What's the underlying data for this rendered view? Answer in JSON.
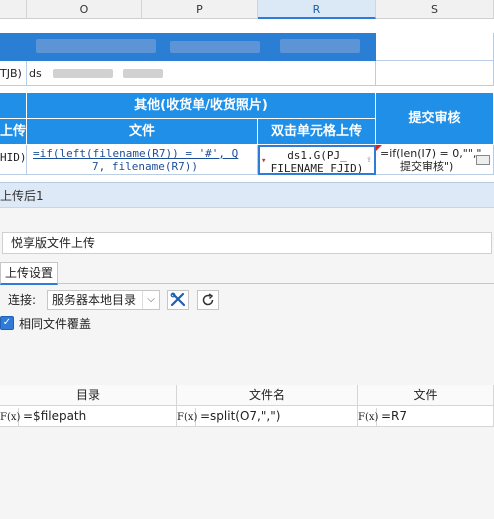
{
  "sheet": {
    "columns": [
      "O",
      "P",
      "R",
      "S"
    ],
    "selected_column": "R",
    "row_ds_text": "ds",
    "left_fragment_1": "TJB)",
    "left_fragment_2": "上传",
    "left_fragment_3": "HID)",
    "group_header": "其他(收货单/收货照片)",
    "col_file_header": "文件",
    "col_upload_header": "双击单元格上传",
    "col_submit_header": "提交审核",
    "formula_o": "=if(left(filename(R7)) = '#', Q",
    "formula_o_line2": "7, filename(R7))",
    "formula_r": "ds1.G(PJ_",
    "formula_r_line2": "FILENAME_FJID)",
    "formula_s": "=if(len(I7) = 0,\"\",\"",
    "formula_s_line2": "提交审核\")"
  },
  "panel": {
    "title": "上传后1",
    "widget_name": "悦享版文件上传",
    "tab_label": "上传设置",
    "connection_label": "连接:",
    "connection_value": "服务器本地目录",
    "overwrite_label": "相同文件覆盖",
    "overwrite_checked": true,
    "table_headers": [
      "目录",
      "文件名",
      "文件"
    ],
    "rows": [
      {
        "directory": "=$filepath",
        "filename": "=split(O7,\",\")",
        "file": "=R7"
      }
    ]
  },
  "colors": {
    "accent": "#2f7bd9",
    "header_blue": "#1f8fe8"
  }
}
